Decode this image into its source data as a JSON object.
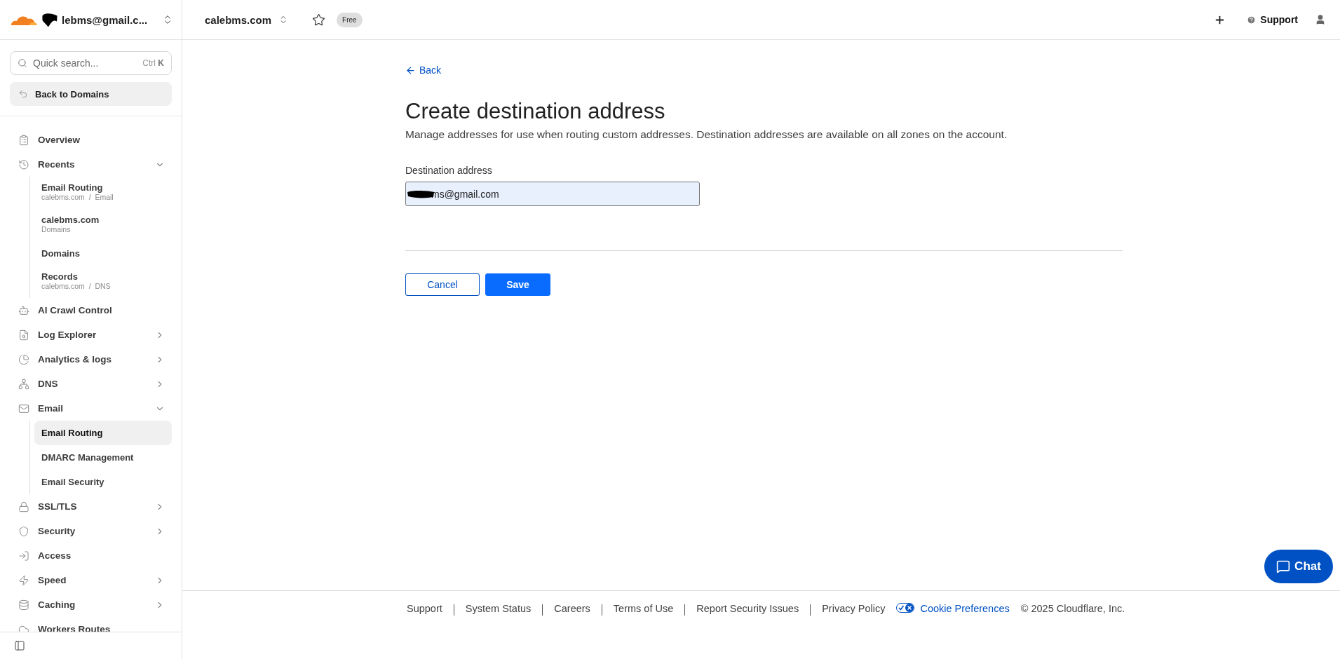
{
  "account": {
    "name": "lebms@gmail.c..."
  },
  "zone": {
    "name": "calebms.com",
    "plan": "Free"
  },
  "top_actions": {
    "support": "Support"
  },
  "search": {
    "placeholder": "Quick search...",
    "shortcut_mod": "Ctrl",
    "shortcut_key": "K"
  },
  "back_to_domains": "Back to Domains",
  "nav": [
    {
      "label": "Overview"
    },
    {
      "label": "Recents",
      "expanded": true,
      "children": [
        {
          "label": "Email Routing",
          "sublabel": "calebms.com  /  Email",
          "selected": false
        },
        {
          "label": "calebms.com",
          "sublabel": "Domains",
          "selected": false
        },
        {
          "label": "Domains",
          "selected": false
        },
        {
          "label": "Records",
          "sublabel": "calebms.com  /  DNS",
          "selected": false
        }
      ]
    },
    {
      "label": "AI Crawl Control"
    },
    {
      "label": "Log Explorer",
      "expanded": false
    },
    {
      "label": "Analytics & logs",
      "expanded": false
    },
    {
      "label": "DNS",
      "expanded": false
    },
    {
      "label": "Email",
      "expanded": true,
      "children": [
        {
          "label": "Email Routing",
          "selected": true
        },
        {
          "label": "DMARC Management",
          "selected": false
        },
        {
          "label": "Email Security",
          "selected": false
        }
      ]
    },
    {
      "label": "SSL/TLS",
      "expanded": false
    },
    {
      "label": "Security",
      "expanded": false
    },
    {
      "label": "Access"
    },
    {
      "label": "Speed",
      "expanded": false
    },
    {
      "label": "Caching",
      "expanded": false
    },
    {
      "label": "Workers Routes"
    }
  ],
  "page": {
    "back": "Back",
    "title": "Create destination address",
    "description": "Manage addresses for use when routing custom addresses. Destination addresses are available on all zones on the account.",
    "field_label": "Destination address",
    "field_value": "ms@gmail.com",
    "cancel": "Cancel",
    "save": "Save"
  },
  "footer": {
    "links": [
      "Support",
      "System Status",
      "Careers",
      "Terms of Use",
      "Report Security Issues",
      "Privacy Policy"
    ],
    "cookie": "Cookie Preferences",
    "copyright": "© 2025 Cloudflare, Inc."
  },
  "chat": "Chat"
}
